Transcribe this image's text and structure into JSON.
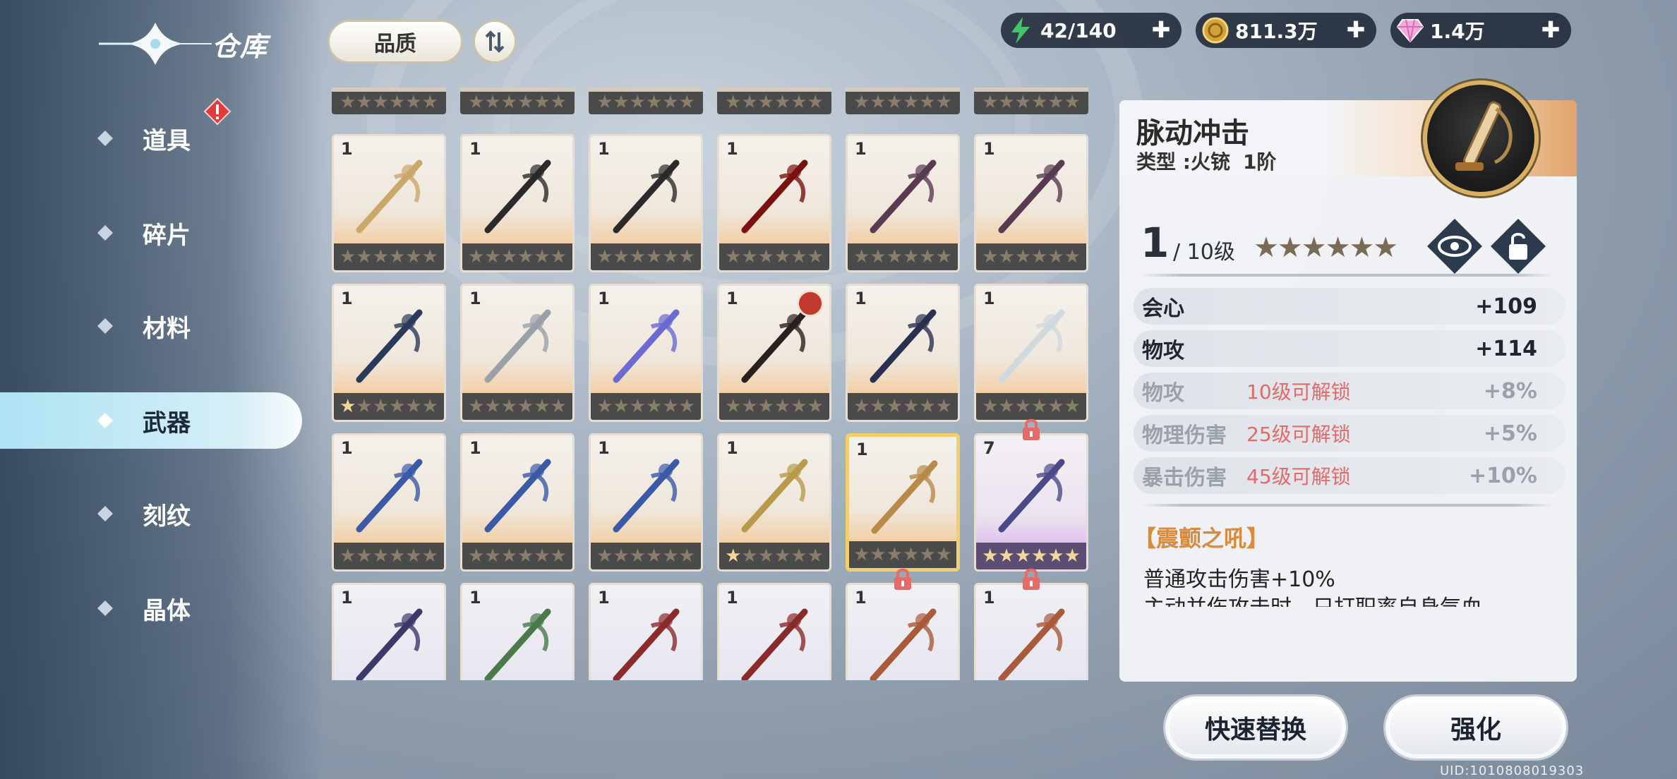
{
  "header": {
    "title": "仓库",
    "sort_label": "品质",
    "order_icon": "sort-order-icon"
  },
  "resources": [
    {
      "name": "stamina",
      "value": "42/140",
      "icon": "lightning-icon",
      "color": "#46c46a"
    },
    {
      "name": "gold",
      "value": "811.3万",
      "icon": "gold-coin-icon",
      "color": "#d4a23a"
    },
    {
      "name": "diamond",
      "value": "1.4万",
      "icon": "diamond-icon",
      "color": "#f08ad2"
    }
  ],
  "sidebar": {
    "items": [
      {
        "label": "道具",
        "active": false,
        "alert": true
      },
      {
        "label": "碎片",
        "active": false,
        "alert": false
      },
      {
        "label": "材料",
        "active": false,
        "alert": false
      },
      {
        "label": "武器",
        "active": true,
        "alert": false
      },
      {
        "label": "刻纹",
        "active": false,
        "alert": false
      },
      {
        "label": "晶体",
        "active": false,
        "alert": false
      }
    ]
  },
  "grid": {
    "rows": [
      [
        {
          "level": "1",
          "stars_lit": 0,
          "weapon": "spear"
        },
        {
          "level": "1",
          "stars_lit": 0,
          "weapon": "gauntlet-dark"
        },
        {
          "level": "1",
          "stars_lit": 0,
          "weapon": "gauntlet-dark"
        },
        {
          "level": "1",
          "stars_lit": 0,
          "weapon": "claw-red"
        },
        {
          "level": "1",
          "stars_lit": 0,
          "weapon": "claw-purple"
        },
        {
          "level": "1",
          "stars_lit": 0,
          "weapon": "claw-purple"
        }
      ],
      [
        {
          "level": "1",
          "stars_lit": 1,
          "weapon": "claw-blue"
        },
        {
          "level": "1",
          "stars_lit": 0,
          "weapon": "staff-silver"
        },
        {
          "level": "1",
          "stars_lit": 0,
          "weapon": "orb-staff"
        },
        {
          "level": "1",
          "stars_lit": 0,
          "weapon": "eye-staff",
          "equipped": true
        },
        {
          "level": "1",
          "stars_lit": 0,
          "weapon": "bow-dark"
        },
        {
          "level": "1",
          "stars_lit": 0,
          "weapon": "scythe-white"
        }
      ],
      [
        {
          "level": "1",
          "stars_lit": 0,
          "weapon": "bow-blue"
        },
        {
          "level": "1",
          "stars_lit": 0,
          "weapon": "bow-blue"
        },
        {
          "level": "1",
          "stars_lit": 0,
          "weapon": "bow-blue"
        },
        {
          "level": "1",
          "stars_lit": 1,
          "weapon": "bow-gold"
        },
        {
          "level": "1",
          "stars_lit": 0,
          "weapon": "gun-brass",
          "selected": true
        },
        {
          "level": "7",
          "stars_lit": 6,
          "weapon": "crossbow-purple",
          "purple": true,
          "locked": true
        }
      ],
      [
        {
          "level": "1",
          "stars_lit": 0,
          "weapon": "blade-purple"
        },
        {
          "level": "1",
          "stars_lit": 0,
          "weapon": "sword-green"
        },
        {
          "level": "1",
          "stars_lit": 0,
          "weapon": "dagger-red"
        },
        {
          "level": "1",
          "stars_lit": 0,
          "weapon": "dagger-red"
        },
        {
          "level": "1",
          "stars_lit": 0,
          "weapon": "axe",
          "locked": true
        },
        {
          "level": "1",
          "stars_lit": 0,
          "weapon": "axe",
          "locked": true
        }
      ]
    ]
  },
  "detail": {
    "name": "脉动冲击",
    "type": "类型 :火铳",
    "rank": "1阶",
    "level": "1",
    "max_level": "/ 10级",
    "stars_total": 6,
    "stats": [
      {
        "name": "会心",
        "value": "+109",
        "unlock": "",
        "locked": false
      },
      {
        "name": "物攻",
        "value": "+114",
        "unlock": "",
        "locked": false
      },
      {
        "name": "物攻",
        "value": "+8%",
        "unlock": "10级可解锁",
        "locked": true
      },
      {
        "name": "物理伤害",
        "value": "+5%",
        "unlock": "25级可解锁",
        "locked": true
      },
      {
        "name": "暴击伤害",
        "value": "+10%",
        "unlock": "45级可解锁",
        "locked": true
      }
    ],
    "skill_name": "【震颤之吼】",
    "skill_desc": "普通攻击伤害+10%",
    "skill_desc_2": "主动并伤攻击时，只打职率自身气血"
  },
  "actions": {
    "replace_label": "快速替换",
    "enhance_label": "强化"
  },
  "uid": "UID:1010808019303"
}
